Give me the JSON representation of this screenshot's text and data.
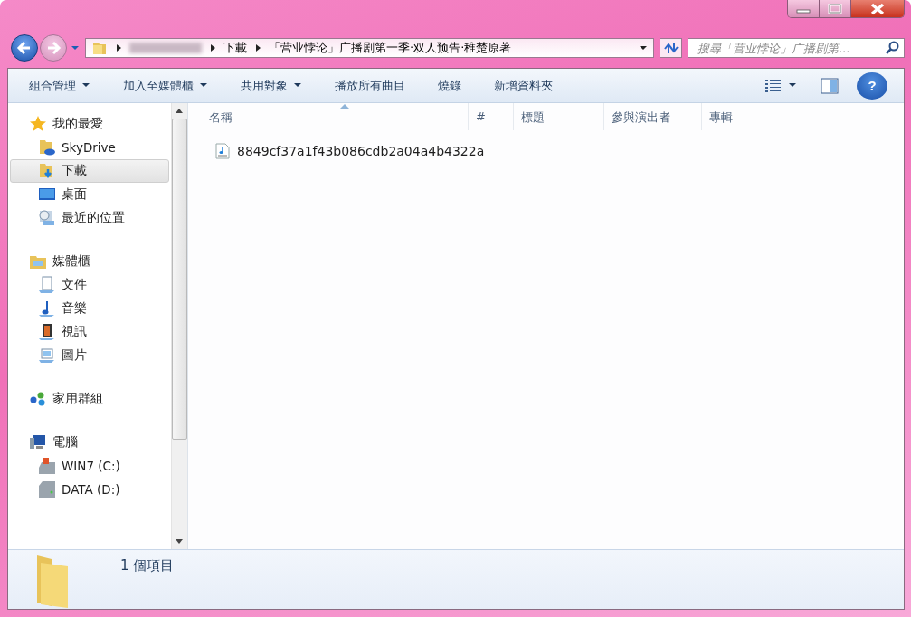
{
  "address": {
    "segments": [
      {
        "kind": "blurred"
      },
      {
        "kind": "text",
        "label": "下載"
      },
      {
        "kind": "text",
        "label": "「营业悖论」广播剧第一季·双人预告·稚楚原著"
      }
    ]
  },
  "search": {
    "placeholder": "搜尋「营业悖论」广播剧第..."
  },
  "toolbar": [
    {
      "label": "組合管理",
      "dropdown": true
    },
    {
      "label": "加入至媒體櫃",
      "dropdown": true
    },
    {
      "label": "共用對象",
      "dropdown": true
    },
    {
      "label": "播放所有曲目",
      "dropdown": false
    },
    {
      "label": "燒錄",
      "dropdown": false
    },
    {
      "label": "新增資料夾",
      "dropdown": false
    }
  ],
  "nav": [
    {
      "label": "我的最愛",
      "kind": "star",
      "selected": false,
      "children": [
        {
          "label": "SkyDrive",
          "kind": "cloud",
          "selected": false
        },
        {
          "label": "下載",
          "kind": "download",
          "selected": true
        },
        {
          "label": "桌面",
          "kind": "desktop",
          "selected": false
        },
        {
          "label": "最近的位置",
          "kind": "recent",
          "selected": false
        }
      ]
    },
    {
      "label": "媒體櫃",
      "kind": "library",
      "selected": false,
      "children": [
        {
          "label": "文件",
          "kind": "document",
          "selected": false
        },
        {
          "label": "音樂",
          "kind": "music",
          "selected": false
        },
        {
          "label": "視訊",
          "kind": "video",
          "selected": false
        },
        {
          "label": "圖片",
          "kind": "picture",
          "selected": false
        }
      ]
    },
    {
      "label": "家用群組",
      "kind": "homegroup",
      "selected": false
    },
    {
      "label": "電腦",
      "kind": "computer",
      "selected": false,
      "children": [
        {
          "label": "WIN7 (C:)",
          "kind": "windrive",
          "selected": false
        },
        {
          "label": "DATA (D:)",
          "kind": "drive",
          "selected": false
        }
      ]
    }
  ],
  "columns": [
    {
      "label": "名稱",
      "sorted": true
    },
    {
      "label": "#",
      "sorted": false
    },
    {
      "label": "標題",
      "sorted": false
    },
    {
      "label": "參與演出者",
      "sorted": false
    },
    {
      "label": "專輯",
      "sorted": false
    }
  ],
  "files": [
    {
      "name": "8849cf37a1f43b086cdb2a04a4b4322a",
      "kind": "audio"
    }
  ],
  "help": {
    "label": "?"
  },
  "status": {
    "count": "1 個項目"
  }
}
